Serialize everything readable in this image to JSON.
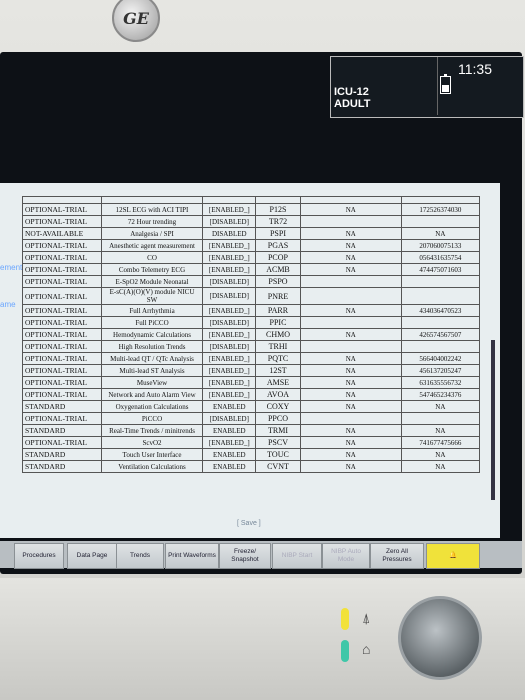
{
  "header": {
    "bed_label": "ICU-12",
    "patient_type": "ADULT",
    "time": "11:35"
  },
  "sidebar_fragments": [
    "ement",
    "ame"
  ],
  "table": {
    "rows": [
      {
        "status": "OPTIONAL-TRIAL",
        "feature": "12SL ECG with ACI TIPI",
        "state": "[ENABLED_]",
        "code": "P12S",
        "col5": "NA",
        "key": "172526374030"
      },
      {
        "status": "OPTIONAL-TRIAL",
        "feature": "72 Hour trending",
        "state": "[DISABLED]",
        "code": "TR72",
        "col5": "",
        "key": ""
      },
      {
        "status": "NOT-AVAILABLE",
        "feature": "Analgesia / SPI",
        "state": "DISABLED",
        "code": "PSPI",
        "col5": "NA",
        "key": "NA"
      },
      {
        "status": "OPTIONAL-TRIAL",
        "feature": "Anesthetic agent measurement",
        "state": "[ENABLED_]",
        "code": "PGAS",
        "col5": "NA",
        "key": "207060075133"
      },
      {
        "status": "OPTIONAL-TRIAL",
        "feature": "CO",
        "state": "[ENABLED_]",
        "code": "PCOP",
        "col5": "NA",
        "key": "056431635754"
      },
      {
        "status": "OPTIONAL-TRIAL",
        "feature": "Combo Telemetry ECG",
        "state": "[ENABLED_]",
        "code": "ACMB",
        "col5": "NA",
        "key": "474475071603"
      },
      {
        "status": "OPTIONAL-TRIAL",
        "feature": "E-SpO2 Module Neonatal",
        "state": "[DISABLED]",
        "code": "PSPO",
        "col5": "",
        "key": ""
      },
      {
        "status": "OPTIONAL-TRIAL",
        "feature": "E-sC(A)(O)(V) module NICU SW",
        "state": "[DISABLED]",
        "code": "PNRE",
        "col5": "",
        "key": ""
      },
      {
        "status": "OPTIONAL-TRIAL",
        "feature": "Full Arrhythmia",
        "state": "[ENABLED_]",
        "code": "PARR",
        "col5": "NA",
        "key": "434036470523"
      },
      {
        "status": "OPTIONAL-TRIAL",
        "feature": "Full PiCCO",
        "state": "[DISABLED]",
        "code": "PPIC",
        "col5": "",
        "key": ""
      },
      {
        "status": "OPTIONAL-TRIAL",
        "feature": "Hemodynamic Calculations",
        "state": "[ENABLED_]",
        "code": "CHMO",
        "col5": "NA",
        "key": "426574567507"
      },
      {
        "status": "OPTIONAL-TRIAL",
        "feature": "High Resolution Trends",
        "state": "[DISABLED]",
        "code": "TRHI",
        "col5": "",
        "key": ""
      },
      {
        "status": "OPTIONAL-TRIAL",
        "feature": "Multi-lead QT / QTc Analysis",
        "state": "[ENABLED_]",
        "code": "PQTC",
        "col5": "NA",
        "key": "566404002242"
      },
      {
        "status": "OPTIONAL-TRIAL",
        "feature": "Multi-lead ST Analysis",
        "state": "[ENABLED_]",
        "code": "12ST",
        "col5": "NA",
        "key": "456137205247"
      },
      {
        "status": "OPTIONAL-TRIAL",
        "feature": "MuseView",
        "state": "[ENABLED_]",
        "code": "AMSE",
        "col5": "NA",
        "key": "631635556732"
      },
      {
        "status": "OPTIONAL-TRIAL",
        "feature": "Network and Auto Alarm View",
        "state": "[ENABLED_]",
        "code": "AVOA",
        "col5": "NA",
        "key": "547465234376"
      },
      {
        "status": "STANDARD",
        "feature": "Oxygenation Calculations",
        "state": "ENABLED",
        "code": "COXY",
        "col5": "NA",
        "key": "NA"
      },
      {
        "status": "OPTIONAL-TRIAL",
        "feature": "PiCCO",
        "state": "[DISABLED]",
        "code": "PPCO",
        "col5": "",
        "key": ""
      },
      {
        "status": "STANDARD",
        "feature": "Real-Time Trends / minitrends",
        "state": "ENABLED",
        "code": "TRMI",
        "col5": "NA",
        "key": "NA"
      },
      {
        "status": "OPTIONAL-TRIAL",
        "feature": "ScvO2",
        "state": "[ENABLED_]",
        "code": "PSCV",
        "col5": "NA",
        "key": "741677475666"
      },
      {
        "status": "STANDARD",
        "feature": "Touch User Interface",
        "state": "ENABLED",
        "code": "TOUC",
        "col5": "NA",
        "key": "NA"
      },
      {
        "status": "STANDARD",
        "feature": "Ventilation Calculations",
        "state": "ENABLED",
        "code": "CVNT",
        "col5": "NA",
        "key": "NA"
      }
    ]
  },
  "save_label": "[ Save ]",
  "softkeys": {
    "procedures": "Procedures",
    "data_page": "Data Page",
    "trends": "Trends",
    "print_waveforms": "Print Waveforms",
    "freeze_snapshot": "Freeze/ Snapshot",
    "disabled_1": "NIBP Start",
    "disabled_2": "NIBP Auto Mode",
    "zero_all_pressures": "Zero All Pressures"
  },
  "colors": {
    "accent_yellow": "#f0e23a",
    "accent_teal": "#3fc7a8",
    "screen_bg": "#0d1116"
  }
}
